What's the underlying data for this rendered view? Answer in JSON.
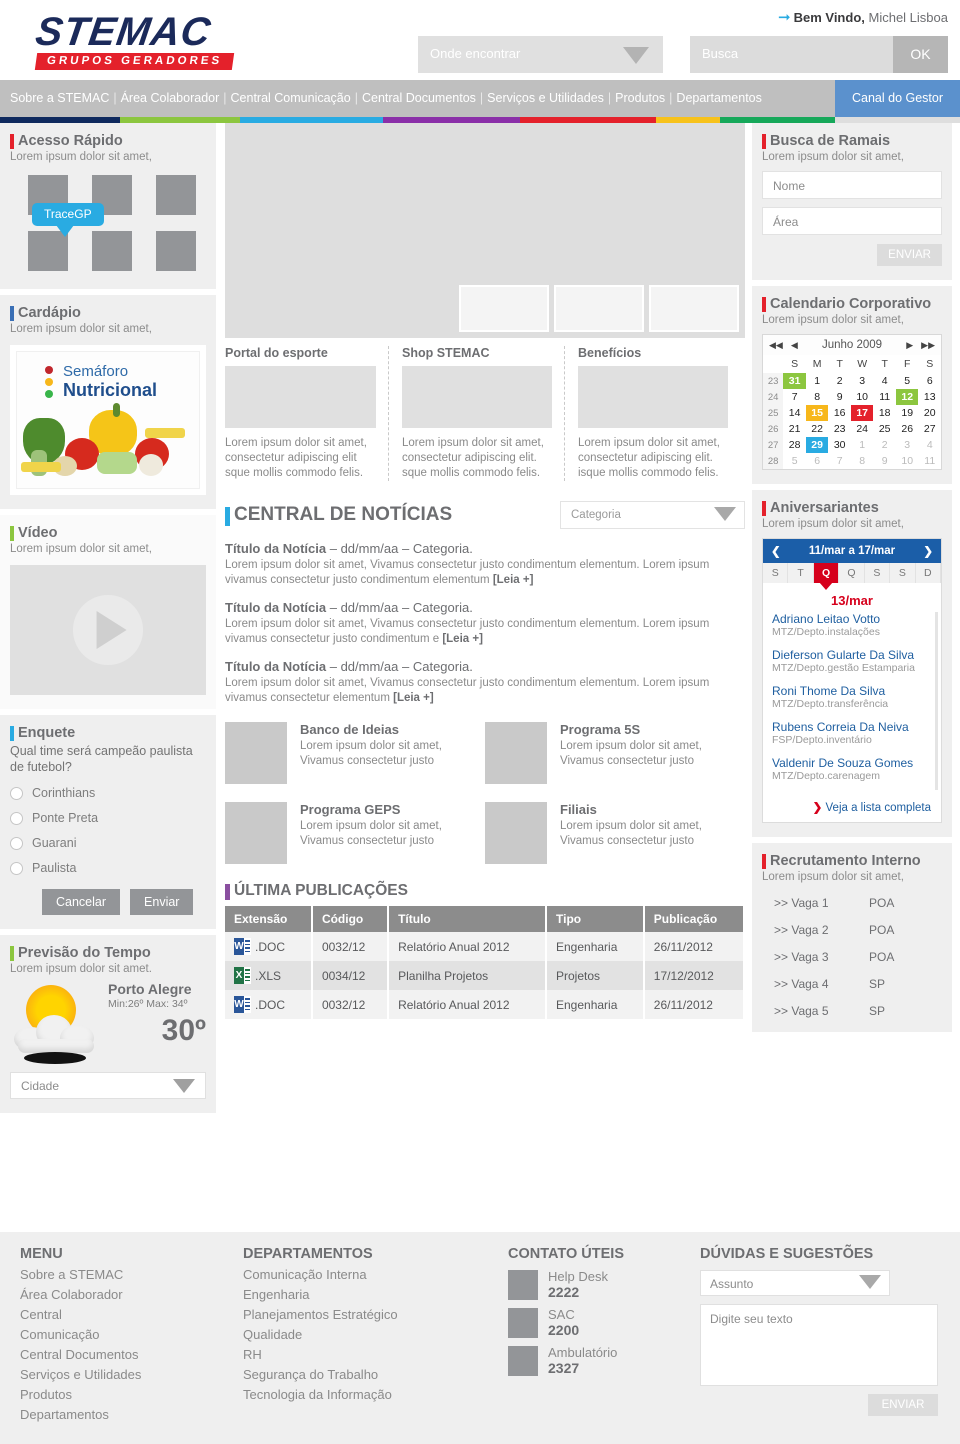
{
  "header": {
    "logo_word": "STEMAC",
    "logo_tag": "GRUPOS GERADORES",
    "welcome_label": "Bem Vindo,",
    "welcome_user": "Michel Lisboa",
    "where_placeholder": "Onde encontrar",
    "search_placeholder": "Busca",
    "ok_label": "OK"
  },
  "nav": {
    "items": [
      "Sobre a STEMAC",
      "Área Colaborador",
      "Central Comunicação",
      "Central Documentos",
      "Serviços e Utilidades",
      "Produtos",
      "Departamentos"
    ],
    "highlight": "Canal do Gestor",
    "colorbar": [
      "#0f2a5e",
      "#8cc63f",
      "#29abe2",
      "#8a2fa8",
      "#e4212b",
      "#f7c21b",
      "#16a85a"
    ]
  },
  "left": {
    "quick": {
      "title": "Acesso Rápido",
      "sub": "Lorem ipsum dolor sit amet,",
      "tooltip": "TraceGP"
    },
    "menu": {
      "title": "Cardápio",
      "sub": "Lorem ipsum dolor sit amet,",
      "img_l1": "Semáforo",
      "img_l2": "Nutricional"
    },
    "video": {
      "title": "Vídeo",
      "sub": "Lorem ipsum dolor sit amet,"
    },
    "poll": {
      "title": "Enquete",
      "question": "Qual time será campeão paulista de futebol?",
      "options": [
        "Corinthians",
        "Ponte Preta",
        "Guarani",
        "Paulista"
      ],
      "cancel": "Cancelar",
      "submit": "Enviar"
    },
    "weather": {
      "title": "Previsão do Tempo",
      "sub": "Lorem ipsum dolor sit amet.",
      "city": "Porto Alegre",
      "minmax": "Min:26º Max: 34º",
      "temp": "30º",
      "select_placeholder": "Cidade"
    }
  },
  "mid": {
    "trio": [
      {
        "title": "Portal do esporte",
        "text": "Lorem ipsum dolor sit amet, consectetur adipiscing elit sque mollis commodo felis."
      },
      {
        "title": "Shop STEMAC",
        "text": "Lorem ipsum dolor sit amet, consectetur adipiscing elit. sque mollis commodo felis."
      },
      {
        "title": "Benefícios",
        "text": "Lorem ipsum dolor sit amet, consectetur adipiscing elit. isque mollis commodo felis."
      }
    ],
    "news": {
      "title": "CENTRAL DE NOTÍCIAS",
      "category_placeholder": "Categoria",
      "items": [
        {
          "head_bold": "Título da Notícia",
          "head_rest": " – dd/mm/aa – Categoria.",
          "text": "Lorem ipsum dolor sit amet, Vivamus consectetur justo condimentum elementum. Lorem ipsum vivamus consectetur justo condimentum elementum ",
          "more": "[Leia +]"
        },
        {
          "head_bold": "Título da Notícia",
          "head_rest": " – dd/mm/aa – Categoria.",
          "text": "Lorem ipsum dolor sit amet, Vivamus consectetur justo condimentum elementum. Lorem ipsum vivamus consectetur justo condimentum e ",
          "more": "[Leia +]"
        },
        {
          "head_bold": "Título da Notícia",
          "head_rest": " – dd/mm/aa – Categoria.",
          "text": "Lorem ipsum dolor sit amet, Vivamus consectetur justo condimentum elementum. Lorem ipsum vivamus consectetur elementum ",
          "more": "[Leia +]"
        }
      ]
    },
    "cards": [
      {
        "title": "Banco de Ideias",
        "text": "Lorem ipsum dolor sit amet, Vivamus consectetur justo"
      },
      {
        "title": "Programa 5S",
        "text": "Lorem ipsum dolor sit amet, Vivamus consectetur justo"
      },
      {
        "title": "Programa GEPS",
        "text": "Lorem ipsum dolor sit amet, Vivamus consectetur justo"
      },
      {
        "title": "Filiais",
        "text": "Lorem ipsum dolor sit amet, Vivamus consectetur justo"
      }
    ],
    "publications": {
      "title": "ÚLTIMA PUBLICAÇÕES",
      "columns": [
        "Extensão",
        "Código",
        "Título",
        "Tipo",
        "Publicação"
      ],
      "rows": [
        {
          "icon": "word-doc-icon",
          "ext": ".DOC",
          "code": "0032/12",
          "name": "Relatório Anual 2012",
          "type": "Engenharia",
          "date": "26/11/2012"
        },
        {
          "icon": "excel-xls-icon",
          "ext": ".XLS",
          "code": "0034/12",
          "name": "Planilha Projetos",
          "type": "Projetos",
          "date": "17/12/2012"
        },
        {
          "icon": "word-doc-icon",
          "ext": ".DOC",
          "code": "0032/12",
          "name": "Relatório Anual 2012",
          "type": "Engenharia",
          "date": "26/11/2012"
        }
      ]
    }
  },
  "right": {
    "ramais": {
      "title": "Busca de Ramais",
      "sub": "Lorem ipsum dolor sit amet,",
      "name_placeholder": "Nome",
      "area_placeholder": "Área",
      "send": "ENVIAR"
    },
    "calendar": {
      "title": "Calendario Corporativo",
      "sub": "Lorem ipsum dolor sit amet,",
      "month": "Junho 2009",
      "weekdays": [
        "S",
        "M",
        "T",
        "W",
        "T",
        "F",
        "S"
      ],
      "weeks": [
        {
          "wk": "23",
          "days": [
            {
              "d": "31",
              "hl": "#8cc63f"
            },
            {
              "d": "1"
            },
            {
              "d": "2"
            },
            {
              "d": "3"
            },
            {
              "d": "4"
            },
            {
              "d": "5"
            },
            {
              "d": "6"
            }
          ]
        },
        {
          "wk": "24",
          "days": [
            {
              "d": "7"
            },
            {
              "d": "8"
            },
            {
              "d": "9"
            },
            {
              "d": "10"
            },
            {
              "d": "11"
            },
            {
              "d": "12",
              "hl": "#8cc63f"
            },
            {
              "d": "13"
            }
          ]
        },
        {
          "wk": "25",
          "days": [
            {
              "d": "14"
            },
            {
              "d": "15",
              "hl": "#f7b71b"
            },
            {
              "d": "16"
            },
            {
              "d": "17",
              "hl": "#e4212b"
            },
            {
              "d": "18"
            },
            {
              "d": "19"
            },
            {
              "d": "20"
            }
          ]
        },
        {
          "wk": "26",
          "days": [
            {
              "d": "21"
            },
            {
              "d": "22"
            },
            {
              "d": "23"
            },
            {
              "d": "24"
            },
            {
              "d": "25"
            },
            {
              "d": "26"
            },
            {
              "d": "27"
            }
          ]
        },
        {
          "wk": "27",
          "days": [
            {
              "d": "28"
            },
            {
              "d": "29",
              "hl": "#29abe2"
            },
            {
              "d": "30"
            },
            {
              "d": "1",
              "off": true
            },
            {
              "d": "2",
              "off": true
            },
            {
              "d": "3",
              "off": true
            },
            {
              "d": "4",
              "off": true
            }
          ]
        },
        {
          "wk": "28",
          "days": [
            {
              "d": "5",
              "off": true
            },
            {
              "d": "6",
              "off": true
            },
            {
              "d": "7",
              "off": true
            },
            {
              "d": "8",
              "off": true
            },
            {
              "d": "9",
              "off": true
            },
            {
              "d": "10",
              "off": true
            },
            {
              "d": "11",
              "off": true
            }
          ]
        }
      ]
    },
    "birthdays": {
      "title": "Aniversariantes",
      "sub": "Lorem ipsum dolor sit amet,",
      "range": "11/mar a 17/mar",
      "weekdays": [
        "S",
        "T",
        "Q",
        "Q",
        "S",
        "S",
        "D"
      ],
      "active_index": 2,
      "date": "13/mar",
      "people": [
        {
          "name": "Adriano Leitao Votto",
          "dept": "MTZ/Depto.instalações"
        },
        {
          "name": "Dieferson Gularte Da Silva",
          "dept": "MTZ/Depto.gestão Estamparia"
        },
        {
          "name": "Roni Thome Da Silva",
          "dept": "MTZ/Depto.transferência"
        },
        {
          "name": "Rubens Correia Da Neiva",
          "dept": "FSP/Depto.inventário"
        },
        {
          "name": "Valdenir De Souza Gomes",
          "dept": "MTZ/Depto.carenagem"
        }
      ],
      "more": "Veja a lista completa"
    },
    "jobs": {
      "title": "Recrutamento Interno",
      "sub": "Lorem ipsum dolor sit amet,",
      "rows": [
        {
          "label": ">> Vaga 1",
          "loc": "POA"
        },
        {
          "label": ">> Vaga 2",
          "loc": "POA"
        },
        {
          "label": ">> Vaga 3",
          "loc": "POA"
        },
        {
          "label": ">> Vaga 4",
          "loc": "SP"
        },
        {
          "label": ">> Vaga 5",
          "loc": "SP"
        }
      ]
    }
  },
  "footer": {
    "menu": {
      "title": "MENU",
      "items": [
        "Sobre a STEMAC",
        "Área Colaborador",
        "Central",
        "Comunicação",
        "Central Documentos",
        "Serviços e Utilidades",
        "Produtos",
        "Departamentos"
      ]
    },
    "departments": {
      "title": "DEPARTAMENTOS",
      "items": [
        "Comunicação Interna",
        "Engenharia",
        "Planejamentos Estratégico",
        "Qualidade",
        "RH",
        "Segurança do Trabalho",
        "Tecnologia da Informação"
      ]
    },
    "contacts": {
      "title": "CONTATO ÚTEIS",
      "items": [
        {
          "name": "Help Desk",
          "number": "2222"
        },
        {
          "name": "SAC",
          "number": "2200"
        },
        {
          "name": "Ambulatório",
          "number": "2327"
        }
      ]
    },
    "suggestions": {
      "title": "DÚVIDAS E SUGESTÕES",
      "subject_placeholder": "Assunto",
      "text_placeholder": "Digite seu texto",
      "send": "ENVIAR"
    }
  }
}
